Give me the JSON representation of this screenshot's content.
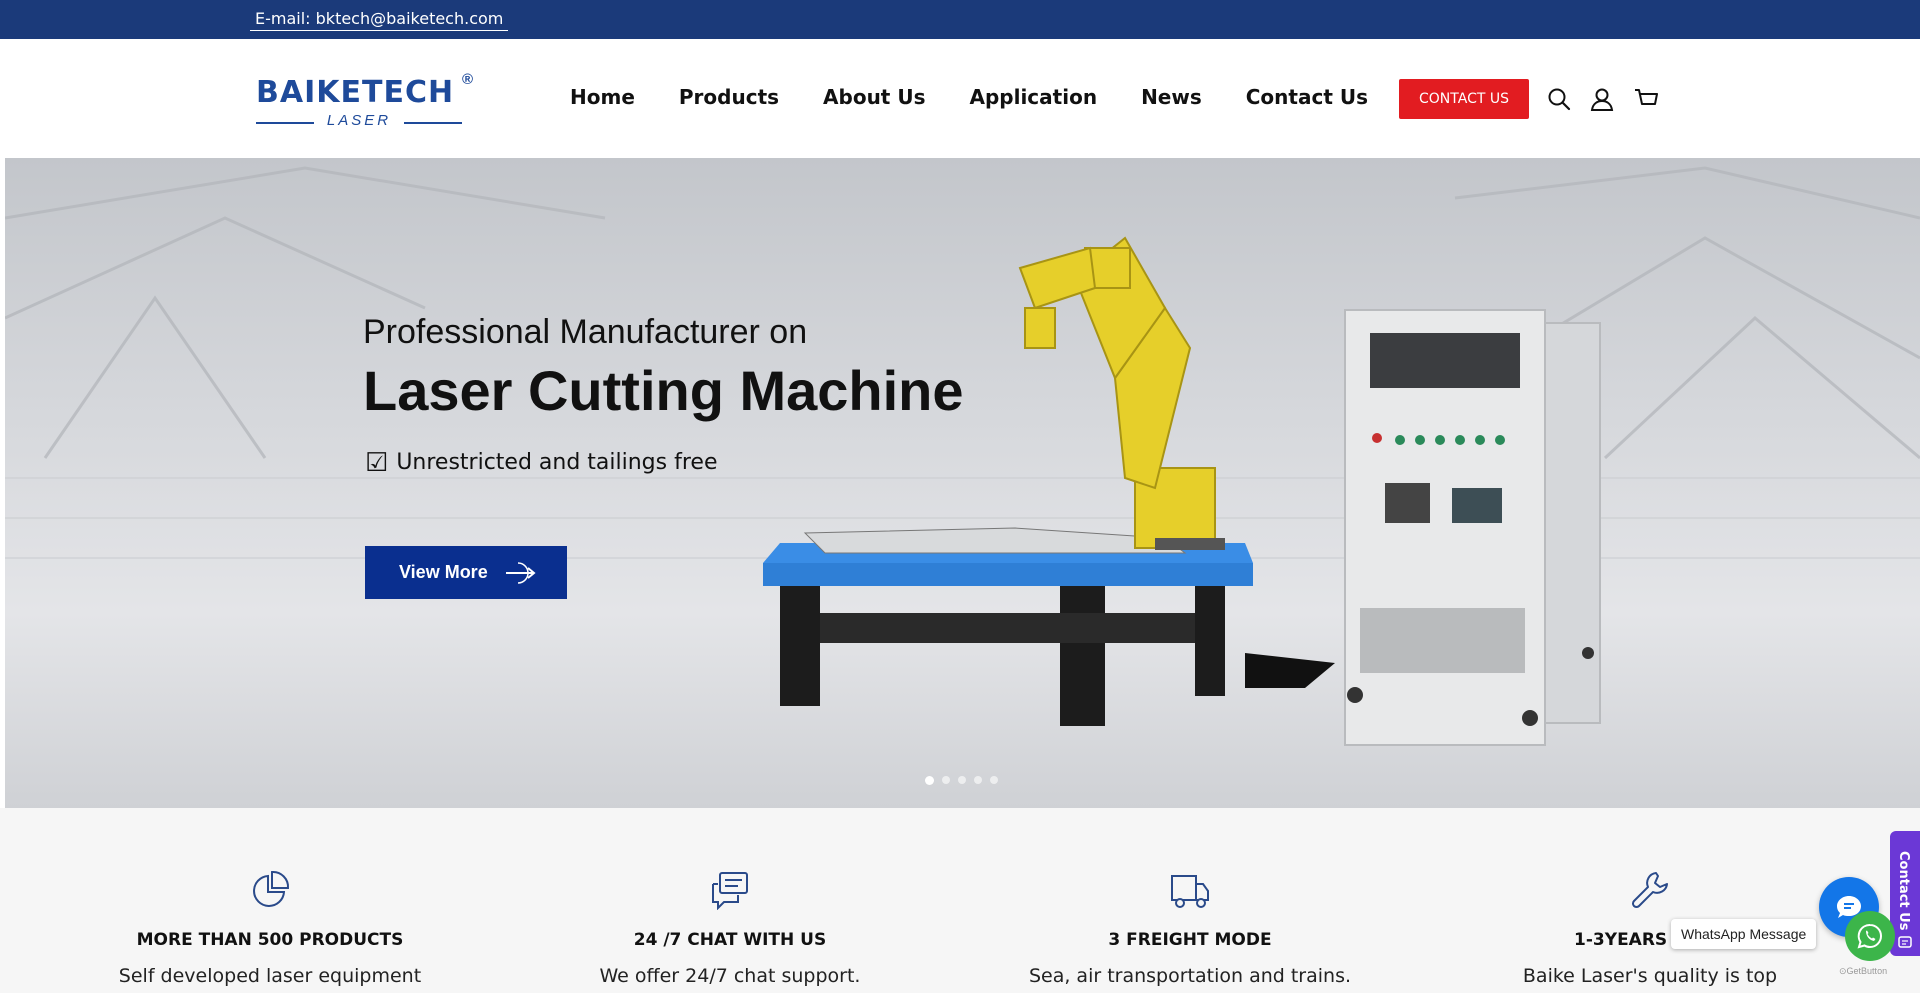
{
  "topbar": {
    "email": "E-mail: bktech@baiketech.com"
  },
  "header": {
    "logo": {
      "brand": "BAIKETECH",
      "registered": "®",
      "sub": "LASER"
    },
    "nav": [
      "Home",
      "Products",
      "About Us",
      "Application",
      "News",
      "Contact Us"
    ],
    "contact_button": "CONTACT US",
    "icons": [
      "search-icon",
      "user-icon",
      "cart-icon"
    ]
  },
  "hero": {
    "subtitle": "Professional Manufacturer on",
    "title": "Laser Cutting Machine",
    "checkmark_text": "Unrestricted and tailings free",
    "button": "View More",
    "slides_total": 5,
    "slide_active": 1,
    "accent_color": "#0a2f8f"
  },
  "features": [
    {
      "icon": "pie-chart-icon",
      "title": "MORE THAN 500 PRODUCTS",
      "desc": "Self developed laser equipment"
    },
    {
      "icon": "chat-icon",
      "title": "24 /7 CHAT WITH US",
      "desc": "We offer 24/7 chat support."
    },
    {
      "icon": "truck-icon",
      "title": "3 FREIGHT MODE",
      "desc": "Sea, air transportation and trains."
    },
    {
      "icon": "wrench-icon",
      "title": "1-3YEARS LONG",
      "desc": "Baike Laser's quality is top"
    }
  ],
  "widgets": {
    "side_tab": "Contact Us",
    "whatsapp_label": "WhatsApp Message",
    "getbutton": "GetButton"
  },
  "colors": {
    "topbar": "#1b3a7a",
    "brand": "#1e4a9a",
    "contact_red": "#e21c21",
    "side_tab": "#6b38d6",
    "chat_blue": "#1376e8",
    "whatsapp_green": "#3cb54a"
  }
}
